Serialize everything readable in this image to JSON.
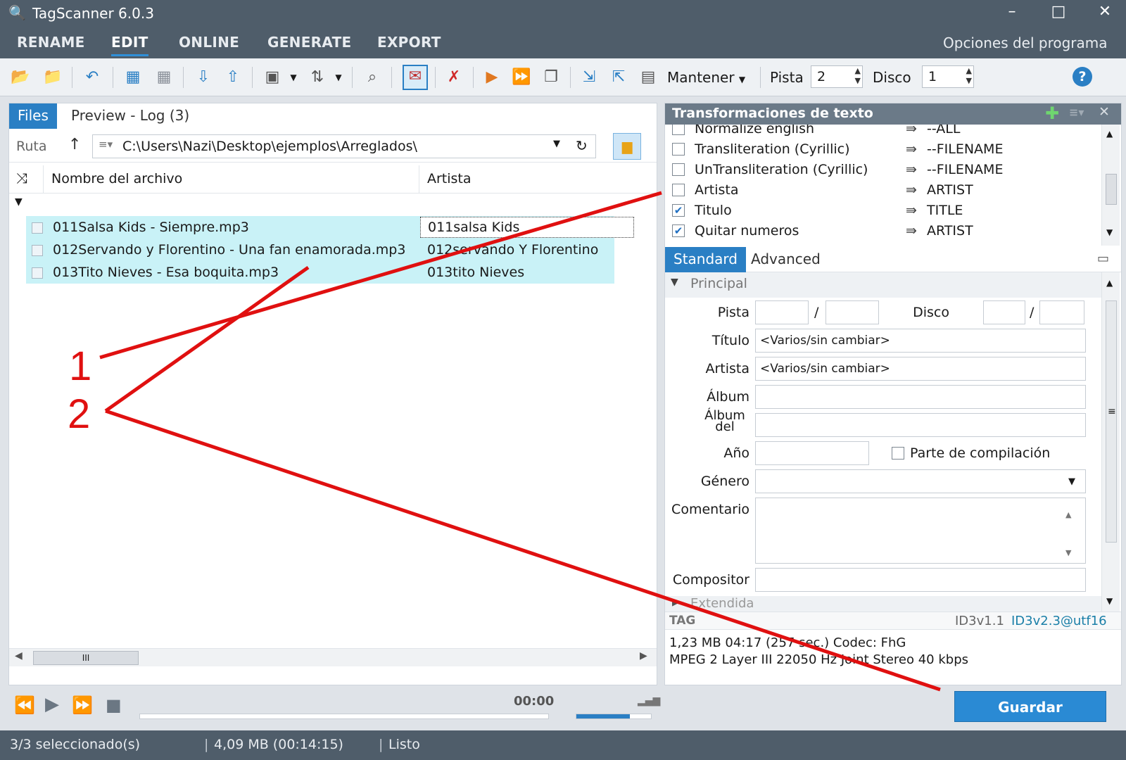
{
  "app": {
    "title": "TagScanner 6.0.3",
    "minimize": "–",
    "maximize": "□",
    "close": "✕"
  },
  "menu": {
    "items": [
      "RENAME",
      "EDIT",
      "ONLINE",
      "GENERATE",
      "EXPORT"
    ],
    "options": "Opciones del programa"
  },
  "toolbar": {
    "keep_label": "Mantener",
    "track_label": "Pista",
    "track_value": "2",
    "disc_label": "Disco",
    "disc_value": "1",
    "help": "?"
  },
  "left": {
    "tabs": [
      "Files",
      "Preview - Log (3)"
    ],
    "path_label": "Ruta",
    "path": "C:\\Users\\Nazi\\Desktop\\ejemplos\\Arreglados\\",
    "columns": [
      "Nombre del archivo",
      "Artista"
    ],
    "rows": [
      {
        "file": "011Salsa Kids - Siempre.mp3",
        "artist": "011salsa Kids"
      },
      {
        "file": "012Servando y Florentino - Una fan enamorada.mp3",
        "artist": "012servando Y Florentino"
      },
      {
        "file": "013Tito Nieves - Esa boquita.mp3",
        "artist": "013tito Nieves"
      }
    ],
    "scroll_thumb": "III"
  },
  "player": {
    "time": "00:00",
    "volume_fraction": 0.72
  },
  "annotations": {
    "one": "1",
    "two": "2"
  },
  "transformations": {
    "title": "Transformaciones de texto",
    "rows": [
      {
        "name": "Normalize english",
        "target": "--ALL",
        "checked": false
      },
      {
        "name": "Transliteration (Cyrillic)",
        "target": "--FILENAME",
        "checked": false
      },
      {
        "name": "UnTransliteration (Cyrillic)",
        "target": "--FILENAME",
        "checked": false
      },
      {
        "name": "Artista",
        "target": "ARTIST",
        "checked": false
      },
      {
        "name": "Titulo",
        "target": "TITLE",
        "checked": true
      },
      {
        "name": "Quitar numeros",
        "target": "ARTIST",
        "checked": true
      }
    ],
    "arrow": "⇛"
  },
  "editor": {
    "tabs": [
      "Standard",
      "Advanced"
    ],
    "section": "Principal",
    "extended": "Extendida",
    "labels": {
      "track": "Pista",
      "disc": "Disco",
      "title": "Título",
      "artist": "Artista",
      "album": "Álbum",
      "album_artist": "Álbum del",
      "year": "Año",
      "genre": "Género",
      "comment": "Comentario",
      "composer": "Compositor",
      "compilation": "Parte de compilación"
    },
    "values": {
      "title": "<Varios/sin cambiar>",
      "artist": "<Varios/sin cambiar>"
    },
    "tag_label": "TAG",
    "tag_v1": "ID3v1.1",
    "tag_v2": "ID3v2.3@utf16",
    "info1": "1,23 MB  04:17 (257 sec.)  Codec: FhG",
    "info2": "MPEG 2 Layer III  22050 Hz  Joint Stereo  40 kbps",
    "save": "Guardar"
  },
  "status": {
    "selected": "3/3 seleccionado(s)",
    "size": "4,09 MB (00:14:15)",
    "state": "Listo"
  },
  "colors": {
    "accent": "#2a7fc4",
    "selection": "#c9f2f7",
    "annotation": "#e01010",
    "chrome": "#4f5d6a"
  }
}
